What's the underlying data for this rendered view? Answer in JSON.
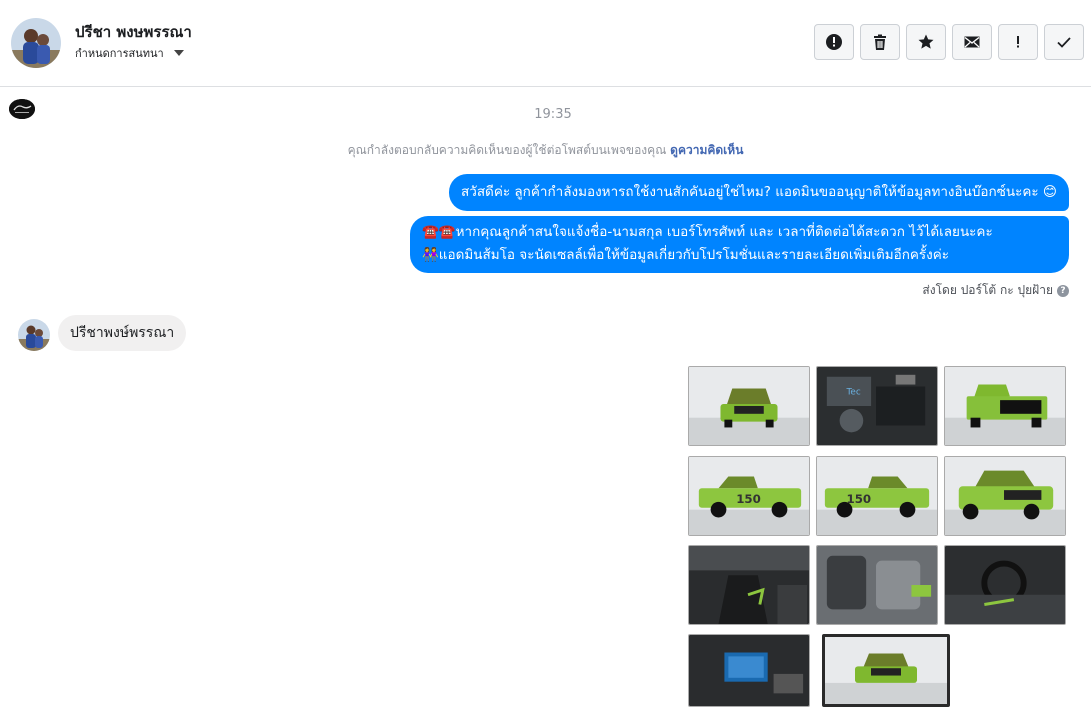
{
  "header": {
    "contact_name": "ปรีชา พงษพรรณา",
    "assign_label": "กำหนดการสนทนา",
    "actions": [
      {
        "name": "spam-button",
        "icon": "alert-circle-icon"
      },
      {
        "name": "delete-button",
        "icon": "trash-icon"
      },
      {
        "name": "star-button",
        "icon": "star-icon"
      },
      {
        "name": "mark-unread-button",
        "icon": "envelope-icon"
      },
      {
        "name": "follow-up-button",
        "icon": "exclamation-icon"
      },
      {
        "name": "mark-done-button",
        "icon": "check-icon"
      }
    ]
  },
  "conversation": {
    "timestamp": "19:35",
    "context_text": "คุณกำลังตอบกลับความคิดเห็นของผู้ใช้ต่อโพสต์บนเพจของคุณ",
    "context_link": "ดูความคิดเห็น",
    "outgoing": [
      {
        "text": "สวัสดีค่ะ ลูกค้ากำลังมองหารถใช้งานสักคันอยู่ใช่ไหม? แอดมินขออนุญาติให้ข้อมูลทางอินบ๊อกซ์นะคะ 😊"
      },
      {
        "line1": "☎️☎️หากคุณลูกค้าสนใจแจ้งชื่อ-นามสกุล เบอร์โทรศัพท์ และ เวลาที่ติดต่อได้สะดวก ไว้ได้เลยนะคะ",
        "line2": "👭แอดมินส้มโอ จะนัดเซลล์เพื่อให้ข้อมูลเกี่ยวกับโปรโมชั่นและรายละเอียดเพิ่มเติมอีกครั้งค่ะ"
      }
    ],
    "sent_by": "ส่งโดย ปอร์โต้ กะ ปุยฝ้าย",
    "incoming": {
      "text": "ปรีชาพงษ์พรรณา"
    }
  },
  "gallery": {
    "images": [
      {
        "name": "truck-front-photo",
        "kind": "front"
      },
      {
        "name": "engine-bay-photo",
        "kind": "engine"
      },
      {
        "name": "truck-rear-photo",
        "kind": "rear"
      },
      {
        "name": "truck-side-left-photo",
        "kind": "side"
      },
      {
        "name": "truck-side-right-photo",
        "kind": "side2"
      },
      {
        "name": "truck-front-angle-photo",
        "kind": "frontangle"
      },
      {
        "name": "interior-console-photo",
        "kind": "interior"
      },
      {
        "name": "interior-seats-photo",
        "kind": "seats"
      },
      {
        "name": "interior-dashboard-photo",
        "kind": "dash"
      },
      {
        "name": "infotainment-screen-photo",
        "kind": "screen"
      },
      {
        "name": "truck-front-thumbnail-photo",
        "kind": "front2",
        "selected": true
      }
    ]
  },
  "colors": {
    "accent": "#0084ff",
    "truck_green": "#8dc63f",
    "link": "#4267b2"
  }
}
